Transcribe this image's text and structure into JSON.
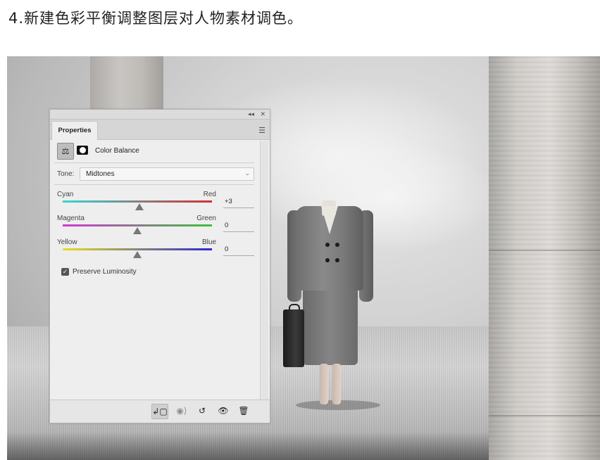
{
  "caption": "4.新建色彩平衡调整图层对人物素材调色。",
  "panel": {
    "tab_label": "Properties",
    "title": "Color Balance",
    "topbar_icons": [
      "collapse-icon",
      "close-icon"
    ],
    "tone": {
      "label": "Tone:",
      "value": "Midtones"
    },
    "sliders": [
      {
        "left": "Cyan",
        "right": "Red",
        "value": "+3",
        "level": 0.515,
        "gradient": [
          "#33d6d6",
          "#d62f2f"
        ]
      },
      {
        "left": "Magenta",
        "right": "Green",
        "value": "0",
        "level": 0.5,
        "gradient": [
          "#d238d2",
          "#3fbf3f"
        ]
      },
      {
        "left": "Yellow",
        "right": "Blue",
        "value": "0",
        "level": 0.5,
        "gradient": [
          "#e4e022",
          "#2a2ad2"
        ]
      }
    ],
    "preserve_luminosity": {
      "label": "Preserve Luminosity",
      "checked": true
    },
    "bottom_icons": [
      "clip-to-layer-icon",
      "view-previous-icon",
      "reset-icon",
      "visibility-icon",
      "trash-icon"
    ]
  }
}
